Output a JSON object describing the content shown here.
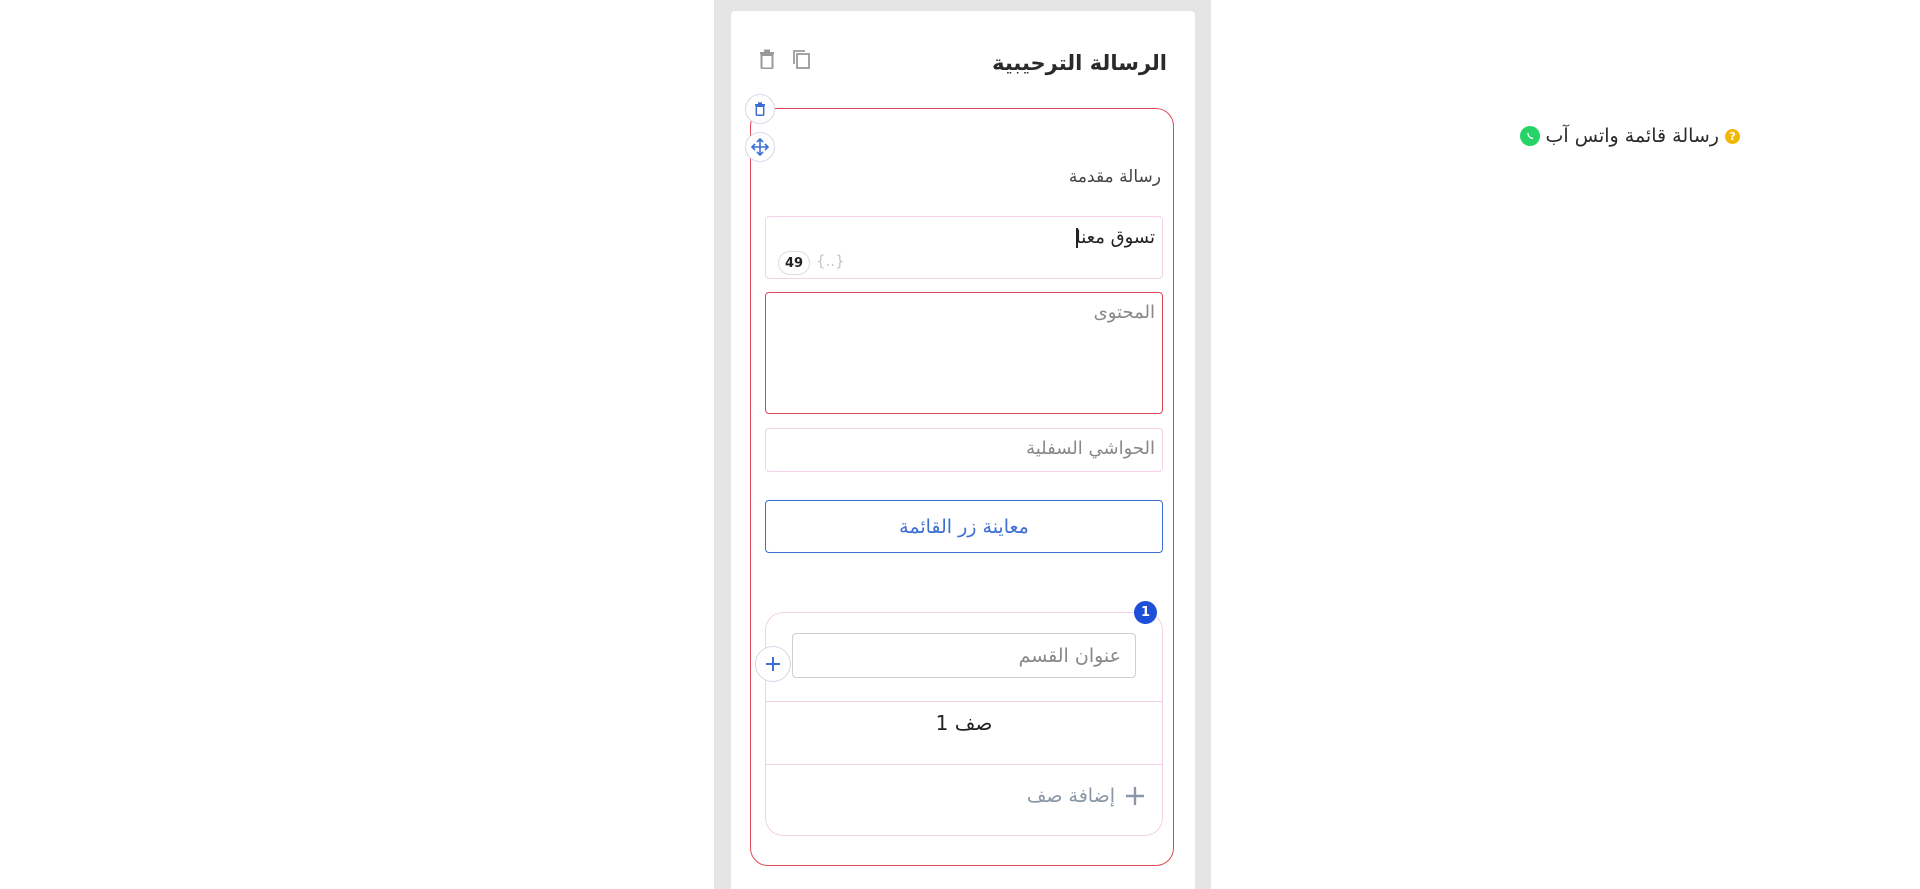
{
  "card": {
    "title": "الرسالة الترحيبية"
  },
  "block": {
    "title": "رسالة قائمة واتس آب",
    "help_glyph": "?"
  },
  "header_field": {
    "label": "رسالة مقدمة",
    "value": "تسوق معنا",
    "counter": "49",
    "variables_glyph": "{..}"
  },
  "content_field": {
    "placeholder": "المحتوى"
  },
  "footer_field": {
    "placeholder": "الحواشي السفلية"
  },
  "preview_button": {
    "label": "معاينة زر القائمة"
  },
  "section": {
    "badge": "1",
    "title_placeholder": "عنوان القسم",
    "rows": [
      "صف 1"
    ],
    "add_row_label": "إضافة صف"
  },
  "colors": {
    "accent_blue": "#3b6fd6",
    "error_red": "#e04a56",
    "whatsapp_green": "#25d366",
    "help_yellow": "#f2b705"
  }
}
